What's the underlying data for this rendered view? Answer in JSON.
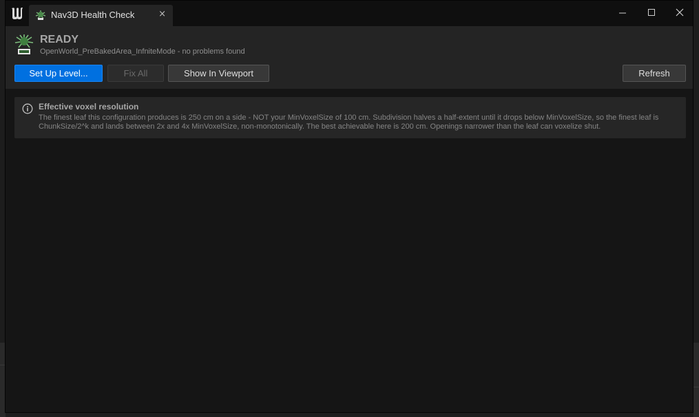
{
  "window": {
    "tab_title": "Nav3D Health Check",
    "tab_close_glyph": "×",
    "icons": {
      "app_logo": "unreal-engine-logo-icon",
      "tab_icon": "nav3d-plugin-icon",
      "minimize": "minimize-icon",
      "maximize": "maximize-icon",
      "close": "close-icon"
    }
  },
  "header": {
    "status_title": "READY",
    "status_subtitle": "OpenWorld_PreBakedArea_InfniteMode - no problems found",
    "buttons": {
      "setup_level": "Set Up Level...",
      "fix_all": "Fix All",
      "show_in_viewport": "Show In Viewport",
      "refresh": "Refresh"
    }
  },
  "notice": {
    "icon": "info-icon",
    "title": "Effective voxel resolution",
    "body": "The finest leaf this configuration produces is 250 cm on a side - NOT your MinVoxelSize of 100 cm. Subdivision halves a half-extent until it drops below MinVoxelSize, so the finest leaf is ChunkSize/2^k and lands between 2x and 4x MinVoxelSize, non-monotonically. The best achievable here is 200 cm. Openings narrower than the leaf can voxelize shut."
  },
  "colors": {
    "accent_primary": "#0070e0",
    "window_bg": "#151515",
    "panel_bg": "#242424"
  }
}
